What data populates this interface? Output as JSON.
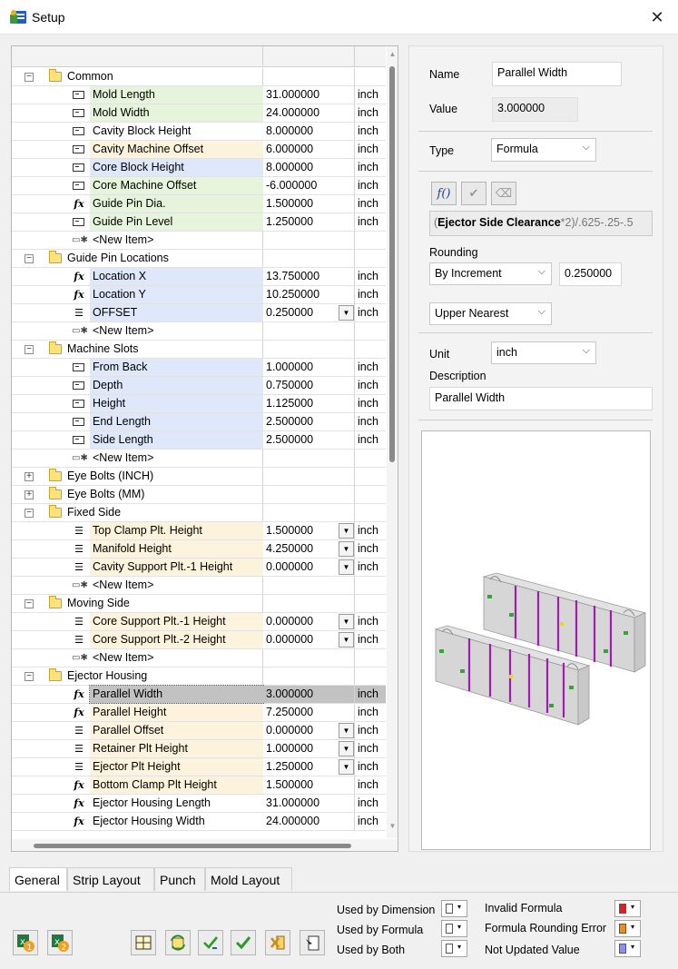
{
  "window": {
    "title": "Setup",
    "close_glyph": "✕"
  },
  "tree": {
    "groups": [
      {
        "label": "Common",
        "expanded": true,
        "items": [
          {
            "label": "Mold Length",
            "icon": "field",
            "value": "31.000000",
            "unit": "inch",
            "bg": "green"
          },
          {
            "label": "Mold Width",
            "icon": "field",
            "value": "24.000000",
            "unit": "inch",
            "bg": "green"
          },
          {
            "label": "Cavity Block Height",
            "icon": "field",
            "value": "8.000000",
            "unit": "inch",
            "bg": "white"
          },
          {
            "label": "Cavity Machine Offset",
            "icon": "field",
            "value": "6.000000",
            "unit": "inch",
            "bg": "yellow"
          },
          {
            "label": "Core Block Height",
            "icon": "field",
            "value": "8.000000",
            "unit": "inch",
            "bg": "blue"
          },
          {
            "label": "Core Machine Offset",
            "icon": "field",
            "value": "-6.000000",
            "unit": "inch",
            "bg": "green"
          },
          {
            "label": "Guide Pin Dia.",
            "icon": "fx",
            "value": "1.500000",
            "unit": "inch",
            "bg": "green"
          },
          {
            "label": "Guide Pin Level",
            "icon": "field",
            "value": "1.250000",
            "unit": "inch",
            "bg": "green"
          },
          {
            "label": "<New Item>",
            "icon": "new"
          }
        ]
      },
      {
        "label": "Guide Pin Locations",
        "expanded": true,
        "items": [
          {
            "label": "Location X",
            "icon": "fx",
            "value": "13.750000",
            "unit": "inch",
            "bg": "blue"
          },
          {
            "label": "Location Y",
            "icon": "fx",
            "value": "10.250000",
            "unit": "inch",
            "bg": "blue"
          },
          {
            "label": "OFFSET",
            "icon": "list",
            "value": "0.250000",
            "unit": "inch",
            "bg": "blue",
            "dropdown": true
          },
          {
            "label": "<New Item>",
            "icon": "new"
          }
        ]
      },
      {
        "label": "Machine Slots",
        "expanded": true,
        "items": [
          {
            "label": "From Back",
            "icon": "field",
            "value": "1.000000",
            "unit": "inch",
            "bg": "blue"
          },
          {
            "label": "Depth",
            "icon": "field",
            "value": "0.750000",
            "unit": "inch",
            "bg": "blue"
          },
          {
            "label": "Height",
            "icon": "field",
            "value": "1.125000",
            "unit": "inch",
            "bg": "blue"
          },
          {
            "label": "End Length",
            "icon": "field",
            "value": "2.500000",
            "unit": "inch",
            "bg": "blue"
          },
          {
            "label": "Side Length",
            "icon": "field",
            "value": "2.500000",
            "unit": "inch",
            "bg": "blue"
          },
          {
            "label": "<New Item>",
            "icon": "new"
          }
        ]
      },
      {
        "label": "Eye Bolts (INCH)",
        "expanded": false,
        "items": []
      },
      {
        "label": "Eye Bolts (MM)",
        "expanded": false,
        "items": []
      },
      {
        "label": "Fixed Side",
        "expanded": true,
        "items": [
          {
            "label": "Top Clamp Plt. Height",
            "icon": "list",
            "value": "1.500000",
            "unit": "inch",
            "bg": "yellow",
            "dropdown": true
          },
          {
            "label": "Manifold Height",
            "icon": "list",
            "value": "4.250000",
            "unit": "inch",
            "bg": "yellow",
            "dropdown": true
          },
          {
            "label": "Cavity Support Plt.-1  Height",
            "icon": "list",
            "value": "0.000000",
            "unit": "inch",
            "bg": "yellow",
            "dropdown": true
          },
          {
            "label": "<New Item>",
            "icon": "new"
          }
        ]
      },
      {
        "label": "Moving Side",
        "expanded": true,
        "items": [
          {
            "label": "Core Support Plt.-1  Height",
            "icon": "list",
            "value": "0.000000",
            "unit": "inch",
            "bg": "yellow",
            "dropdown": true
          },
          {
            "label": "Core Support Plt.-2  Height",
            "icon": "list",
            "value": "0.000000",
            "unit": "inch",
            "bg": "yellow",
            "dropdown": true
          },
          {
            "label": "<New Item>",
            "icon": "new"
          }
        ]
      },
      {
        "label": "Ejector Housing",
        "expanded": true,
        "items": [
          {
            "label": "Parallel Width",
            "icon": "fx",
            "value": "3.000000",
            "unit": "inch",
            "bg": "selected"
          },
          {
            "label": "Parallel Height",
            "icon": "fx",
            "value": "7.250000",
            "unit": "inch",
            "bg": "yellow"
          },
          {
            "label": "Parallel Offset",
            "icon": "list",
            "value": "0.000000",
            "unit": "inch",
            "bg": "yellow",
            "dropdown": true
          },
          {
            "label": "Retainer Plt Height",
            "icon": "list",
            "value": "1.000000",
            "unit": "inch",
            "bg": "yellow",
            "dropdown": true
          },
          {
            "label": "Ejector Plt Height",
            "icon": "list",
            "value": "1.250000",
            "unit": "inch",
            "bg": "yellow",
            "dropdown": true
          },
          {
            "label": "Bottom Clamp Plt Height",
            "icon": "fx",
            "value": "1.500000",
            "unit": "inch",
            "bg": "yellow"
          },
          {
            "label": "Ejector Housing Length",
            "icon": "fx",
            "value": "31.000000",
            "unit": "inch",
            "bg": "white"
          },
          {
            "label": "Ejector Housing Width",
            "icon": "fx",
            "value": "24.000000",
            "unit": "inch",
            "bg": "white"
          }
        ]
      }
    ]
  },
  "props": {
    "name_label": "Name",
    "name_value": "Parallel Width",
    "value_label": "Value",
    "value_value": "3.000000",
    "type_label": "Type",
    "type_value": "Formula",
    "formula_bold": "Ejector Side Clearance",
    "formula_paren": "(",
    "formula_rest": "*2)/.625-.25-.5",
    "rounding_label": "Rounding",
    "rounding_mode": "By Increment",
    "rounding_increment": "0.250000",
    "rounding_direction": "Upper Nearest",
    "unit_label": "Unit",
    "unit_value": "inch",
    "description_label": "Description",
    "description_value": "Parallel Width",
    "formula_buttons": {
      "fx": "f()",
      "check": "✔",
      "clear": "⌫"
    }
  },
  "tabs": [
    "General",
    "Strip Layout",
    "Punch",
    "Mold Layout"
  ],
  "legend": {
    "used_by_dimension": "Used by Dimension",
    "used_by_formula": "Used by Formula",
    "used_by_both": "Used by Both",
    "invalid_formula": "Invalid Formula",
    "formula_rounding_error": "Formula Rounding Error",
    "not_updated_value": "Not Updated Value",
    "colors": {
      "used_by_dimension": "#ffffff",
      "used_by_formula": "#ffffff",
      "used_by_both": "#ffffff",
      "invalid_formula": "#e02020",
      "formula_rounding_error": "#f08c1e",
      "not_updated_value": "#8a8ff0"
    }
  },
  "colors": {
    "row_green": "#e7f4dc",
    "row_yellow": "#fdf3dd",
    "row_blue": "#dfe8fa",
    "row_selected": "#c2c2c2"
  }
}
